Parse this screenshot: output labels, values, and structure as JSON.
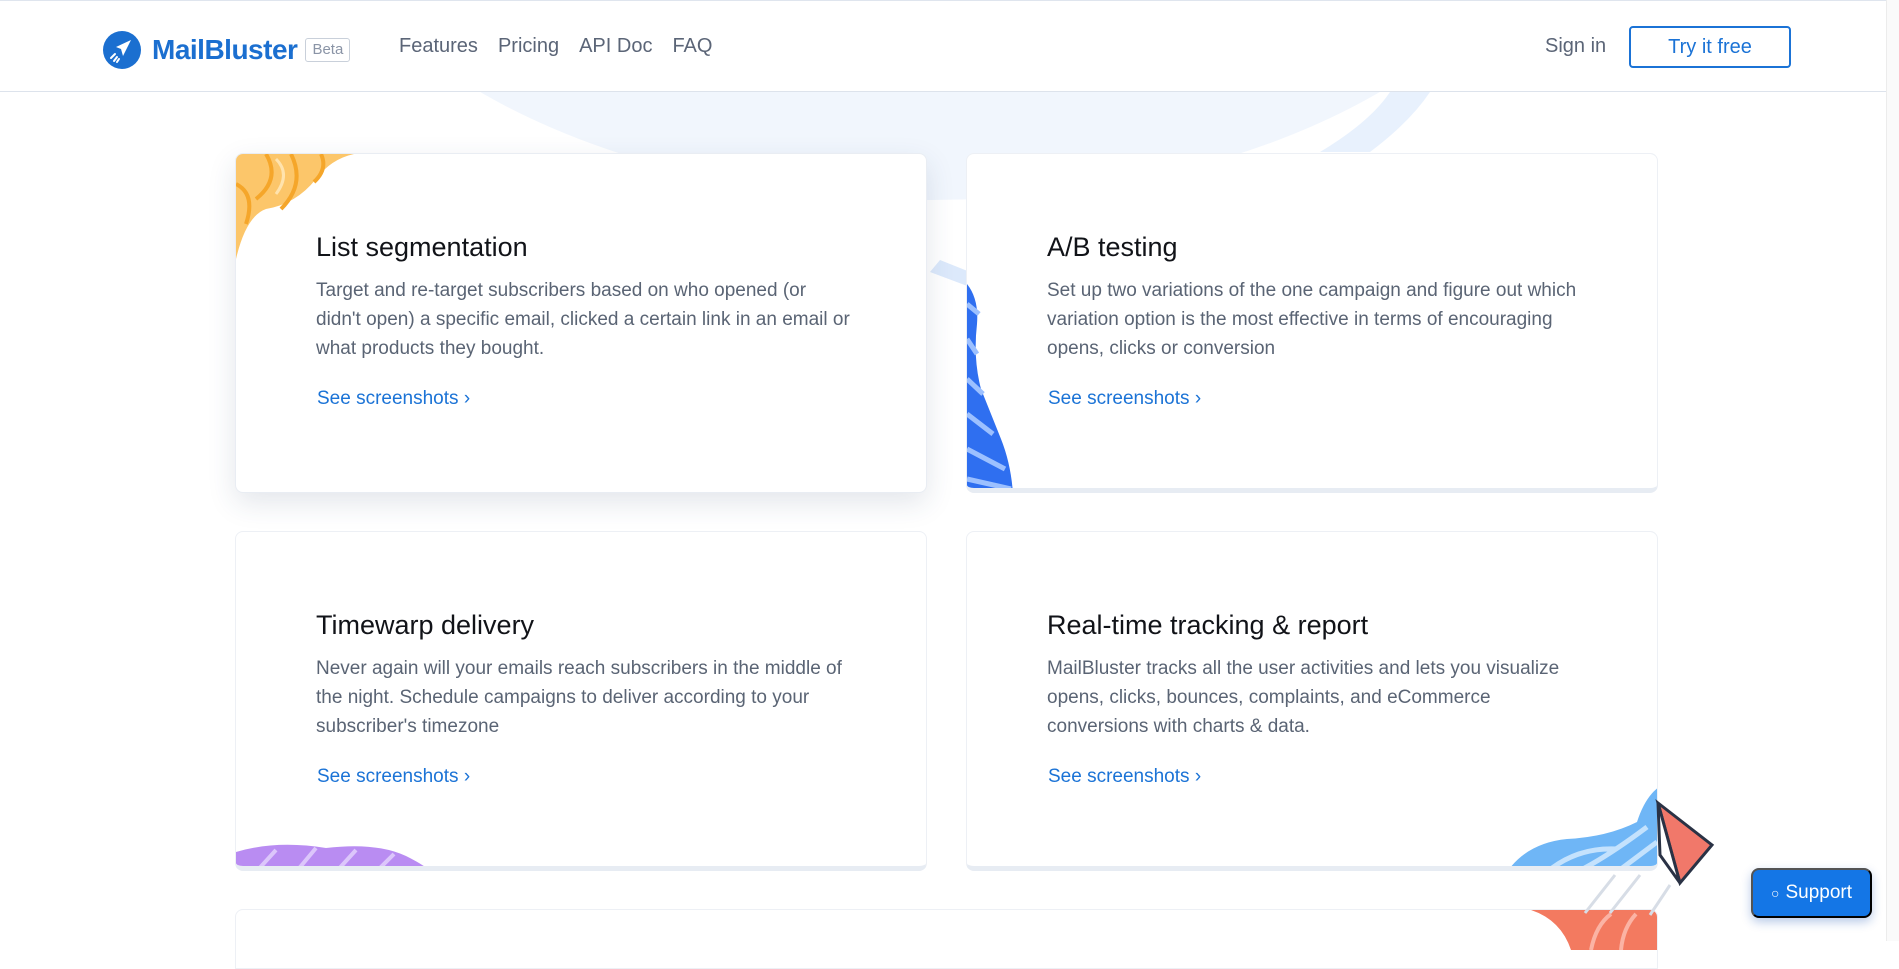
{
  "header": {
    "brand": "MailBluster",
    "badge": "Beta",
    "nav": [
      "Features",
      "Pricing",
      "API Doc",
      "FAQ"
    ],
    "signin": "Sign in",
    "cta": "Try it free"
  },
  "features": [
    {
      "title": "List segmentation",
      "description": "Target and re-target subscribers based on who opened (or didn't open) a specific email, clicked a certain link in an email or what products they bought.",
      "link": "See screenshots"
    },
    {
      "title": "A/B testing",
      "description": "Set up two variations of the one campaign and figure out which variation option is the most effective in terms of encouraging opens, clicks or conversion",
      "link": "See screenshots"
    },
    {
      "title": "Timewarp delivery",
      "description": "Never again will your emails reach subscribers in the middle of the night. Schedule campaigns to deliver according to your subscriber's timezone",
      "link": "See screenshots"
    },
    {
      "title": "Real-time tracking & report",
      "description": "MailBluster tracks all the user activities and lets you visualize opens, clicks, bounces, complaints, and eCommerce conversions with charts & data.",
      "link": "See screenshots"
    }
  ],
  "support": "Support",
  "colors": {
    "brand": "#1b6fd0",
    "link": "#1b73d6",
    "support_bg": "#1476e6"
  }
}
